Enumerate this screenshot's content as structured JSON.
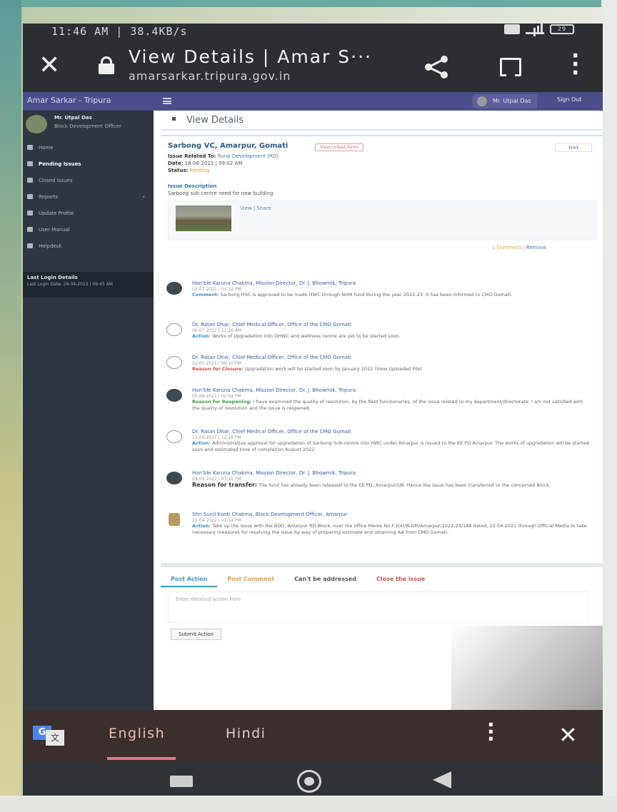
{
  "status_bar": {
    "time_speed": "11:46 AM | 38.4KB/s",
    "battery": "29"
  },
  "browser": {
    "title": "View Details | Amar S···",
    "url": "amarsarkar.tripura.gov.in"
  },
  "site": {
    "brand": "Amar Sarkar - Tripura",
    "user_chip": "Mr. Utpal Das",
    "signout": "Sign Out"
  },
  "sidebar": {
    "user_name": "Mr. Utpal Das",
    "user_office": "Block Development Officer",
    "items": [
      {
        "label": "Home"
      },
      {
        "label": "Pending Issues"
      },
      {
        "label": "Closed Issues"
      },
      {
        "label": "Reports"
      },
      {
        "label": "Update Profile"
      },
      {
        "label": "User Manual"
      },
      {
        "label": "Helpdesk"
      }
    ],
    "login_heading": "Last Login Details",
    "login_text": "Last Login Date: 28-04-2022 | 09:45 AM"
  },
  "content": {
    "breadcrumb": "View Details",
    "issue": {
      "title": "Sarbong VC, Amarpur, Gomati",
      "pill": "View Linked Items",
      "print": "Print",
      "related_label": "Issue Related To:",
      "related_value": "Rural Development (RD)",
      "date_label": "Date:",
      "date_value": "18-06-2021 | 09:02 AM",
      "status_label": "Status:",
      "status_value": "Pending",
      "desc_heading": "Issue Description",
      "desc_text": "Sarbong sub-centre need for new building",
      "attach_links": "View | Share",
      "assign_link": "1 Comment",
      "assign_link2": "Remove"
    },
    "timeline": [
      {
        "name": "Hon'ble Karuna Chakma, Mission Director, Dr. J. Bhowmik, Tripura",
        "date": "03-07-2021 | 03:32 PM",
        "label": "Comment:",
        "label_class": "",
        "text": "Sarbong HSC is approved to be made HWC through NHM fund during the year 2022-23. It has been informed to CMO Gomati.",
        "avatar": "dark"
      },
      {
        "name": "Dr. Ratan Dhar, Chief Medical Officer, Office of the CMO Gomati",
        "date": "06-07-2021 | 11:20 AM",
        "label": "Action:",
        "label_class": "",
        "text": "Works of Upgradation into DHWC and wellness centre are yet to be started soon.",
        "avatar": "light"
      },
      {
        "name": "Dr. Ratan Dhar, Chief Medical Officer, Office of the CMO Gomati",
        "date": "22-07-2021 | 04:10 PM",
        "label": "Reason for Closure:",
        "label_class": "red",
        "text": "Upgradation work will be started soon by January 2022 (View Uploaded File)",
        "avatar": "light"
      },
      {
        "name": "Hon'ble Karuna Chakma, Mission Director, Dr. J. Bhowmik, Tripura",
        "date": "05-08-2021 | 02:54 PM",
        "label": "Reason for Reopening:",
        "label_class": "green",
        "text": "I have examined the quality of resolution, by the field functionaries, of the issue related to my department/directorate. I am not satisfied with the quality of resolution and the issue is reopened.",
        "avatar": "dark"
      },
      {
        "name": "Dr. Ratan Dhar, Chief Medical Officer, Office of the CMO Gomati",
        "date": "13-09-2021 | 12:18 PM",
        "label": "Action:",
        "label_class": "",
        "text": "Administrative approval for upgradation of Sarbong Sub-centre into HWC under Amarpur is issued to the EE PD Amarpur. The works of upgradation will be started soon and estimated time of completion August 2022.",
        "avatar": "light"
      },
      {
        "name": "Hon'ble Karuna Chakma, Mission Director, Dr. J. Bhowmik, Tripura",
        "date": "04-04-2022 | 03:10 PM",
        "label": "Reason for transfer:",
        "label_class": "dark",
        "text": "The fund has already been released to the EE PD, Amarpur/UB. Hence the issue has been transferred to the concerned Block.",
        "avatar": "dark"
      },
      {
        "name": "Shri Sunil Kanti Chakma, Block Development Officer, Amarpur",
        "date": "22-04-2022 | 01:34 PM",
        "label": "Action:",
        "label_class": "",
        "text": "Take up the issue with the BDO, Amarpur RD Block, over the office Memo No.F.3(4)/B-DM/Amarpur/2022-23/188 dated, 22-04-2022 through Official Media to take necessary measures for resolving the issue by way of preparing estimate and obtaining AA from CMO Gomati.",
        "avatar": "gold"
      }
    ],
    "actions": {
      "tabs": [
        "Post Action",
        "Post Comment",
        "Can't be addressed",
        "Close the issue"
      ],
      "input_placeholder": "Enter detailed action here",
      "submit": "Submit Action"
    }
  },
  "translate_bar": {
    "lang_active": "English",
    "lang_other": "Hindi"
  }
}
